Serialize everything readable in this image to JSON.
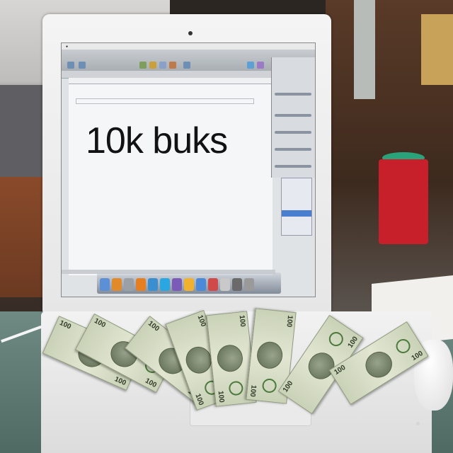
{
  "document": {
    "text": "10k buks"
  },
  "bills": {
    "denomination": "100",
    "count": 8
  }
}
